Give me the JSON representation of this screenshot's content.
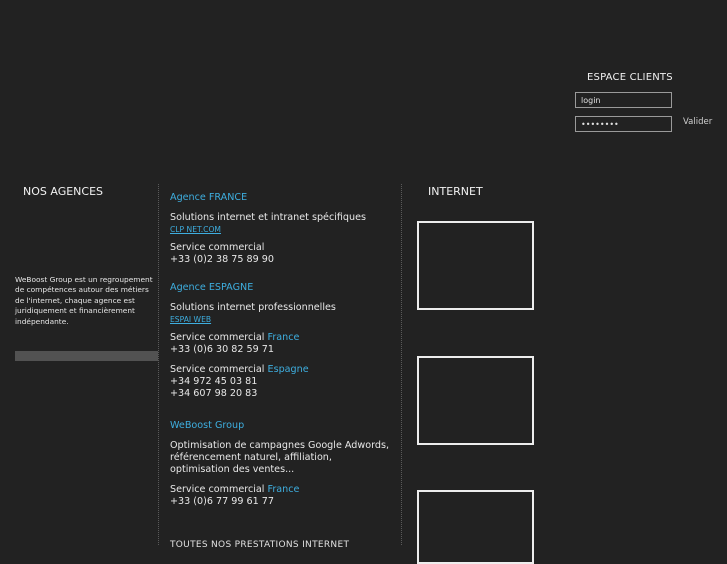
{
  "client": {
    "title": "ESPACE CLIENTS",
    "login_value": "login",
    "password_value": "••••••••",
    "submit_label": "Valider"
  },
  "agencies": {
    "title": "NOS AGENCES",
    "intro": "WeBoost Group est un regroupement de compétences autour des métiers de l'internet, chaque agence est juridiquement et financièrement indépendante."
  },
  "internet": {
    "title": "INTERNET"
  },
  "france": {
    "title": "Agence FRANCE",
    "desc": "Solutions internet et intranet spécifiques",
    "link": "CLP NET.COM",
    "service": "Service commercial",
    "phone": "+33 (0)2 38 75 89 90"
  },
  "espagne": {
    "title": "Agence ESPAGNE",
    "desc": "Solutions internet professionnelles",
    "link": "ESPAI WEB",
    "service": "Service commercial",
    "loc_france": "France",
    "phone_france": "+33 (0)6 30 82 59 71",
    "loc_espagne": "Espagne",
    "phone_es_1": "+34 972 45 03 81",
    "phone_es_2": "+34 607 98 20 83"
  },
  "weboost": {
    "title": "WeBoost Group",
    "desc_1": "Optimisation de campagnes Google Adwords,",
    "desc_2": "référencement naturel, affiliation,",
    "desc_3": "optimisation des ventes...",
    "service": "Service commercial",
    "loc_france": "France",
    "phone": "+33 (0)6 77 99 61 77"
  },
  "bottom_text": "TOUTES NOS PRESTATIONS INTERNET"
}
